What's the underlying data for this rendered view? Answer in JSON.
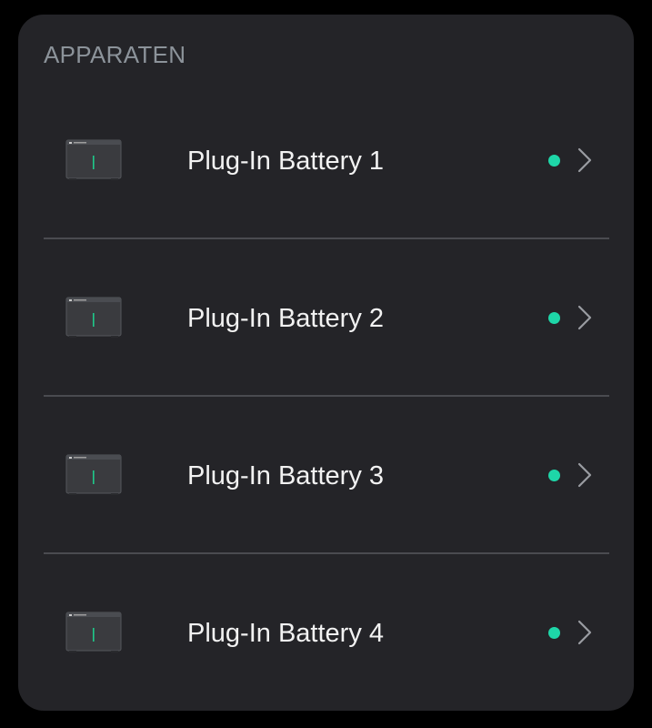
{
  "section": {
    "title": "APPARATEN"
  },
  "devices": [
    {
      "name": "Plug-In Battery 1",
      "status": "online",
      "icon": "battery-device-icon"
    },
    {
      "name": "Plug-In Battery 2",
      "status": "online",
      "icon": "battery-device-icon"
    },
    {
      "name": "Plug-In Battery 3",
      "status": "online",
      "icon": "battery-device-icon"
    },
    {
      "name": "Plug-In Battery 4",
      "status": "online",
      "icon": "battery-device-icon"
    }
  ],
  "colors": {
    "background": "#000000",
    "card": "#242428",
    "status_online": "#1ed6a8",
    "chevron": "#9a9ca2",
    "divider": "#4a4b50",
    "device_led": "#1ec98a"
  },
  "icons": {
    "row_action": "chevron-right-icon",
    "status": "status-dot-icon"
  }
}
